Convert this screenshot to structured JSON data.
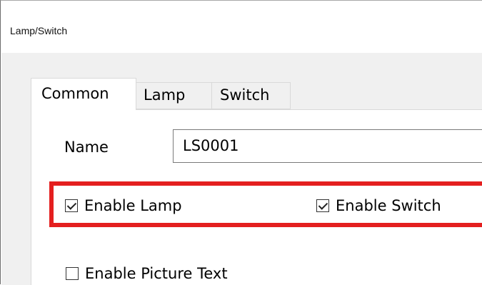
{
  "window": {
    "title": "Lamp/Switch"
  },
  "tabs": [
    {
      "label": "Common",
      "active": true
    },
    {
      "label": "Lamp",
      "active": false
    },
    {
      "label": "Switch",
      "active": false
    }
  ],
  "common": {
    "name_label": "Name",
    "name_value": "LS0001",
    "enable_lamp": {
      "label": "Enable Lamp",
      "checked": true
    },
    "enable_switch": {
      "label": "Enable Switch",
      "checked": true
    },
    "enable_picture_text": {
      "label": "Enable Picture Text",
      "checked": false
    }
  },
  "colors": {
    "highlight": "#e41f1f",
    "dialog_background": "#f0f0f0",
    "panel_background": "#ffffff"
  },
  "icons": {
    "checked": "checkbox-checked-icon",
    "unchecked": "checkbox-unchecked-icon"
  }
}
